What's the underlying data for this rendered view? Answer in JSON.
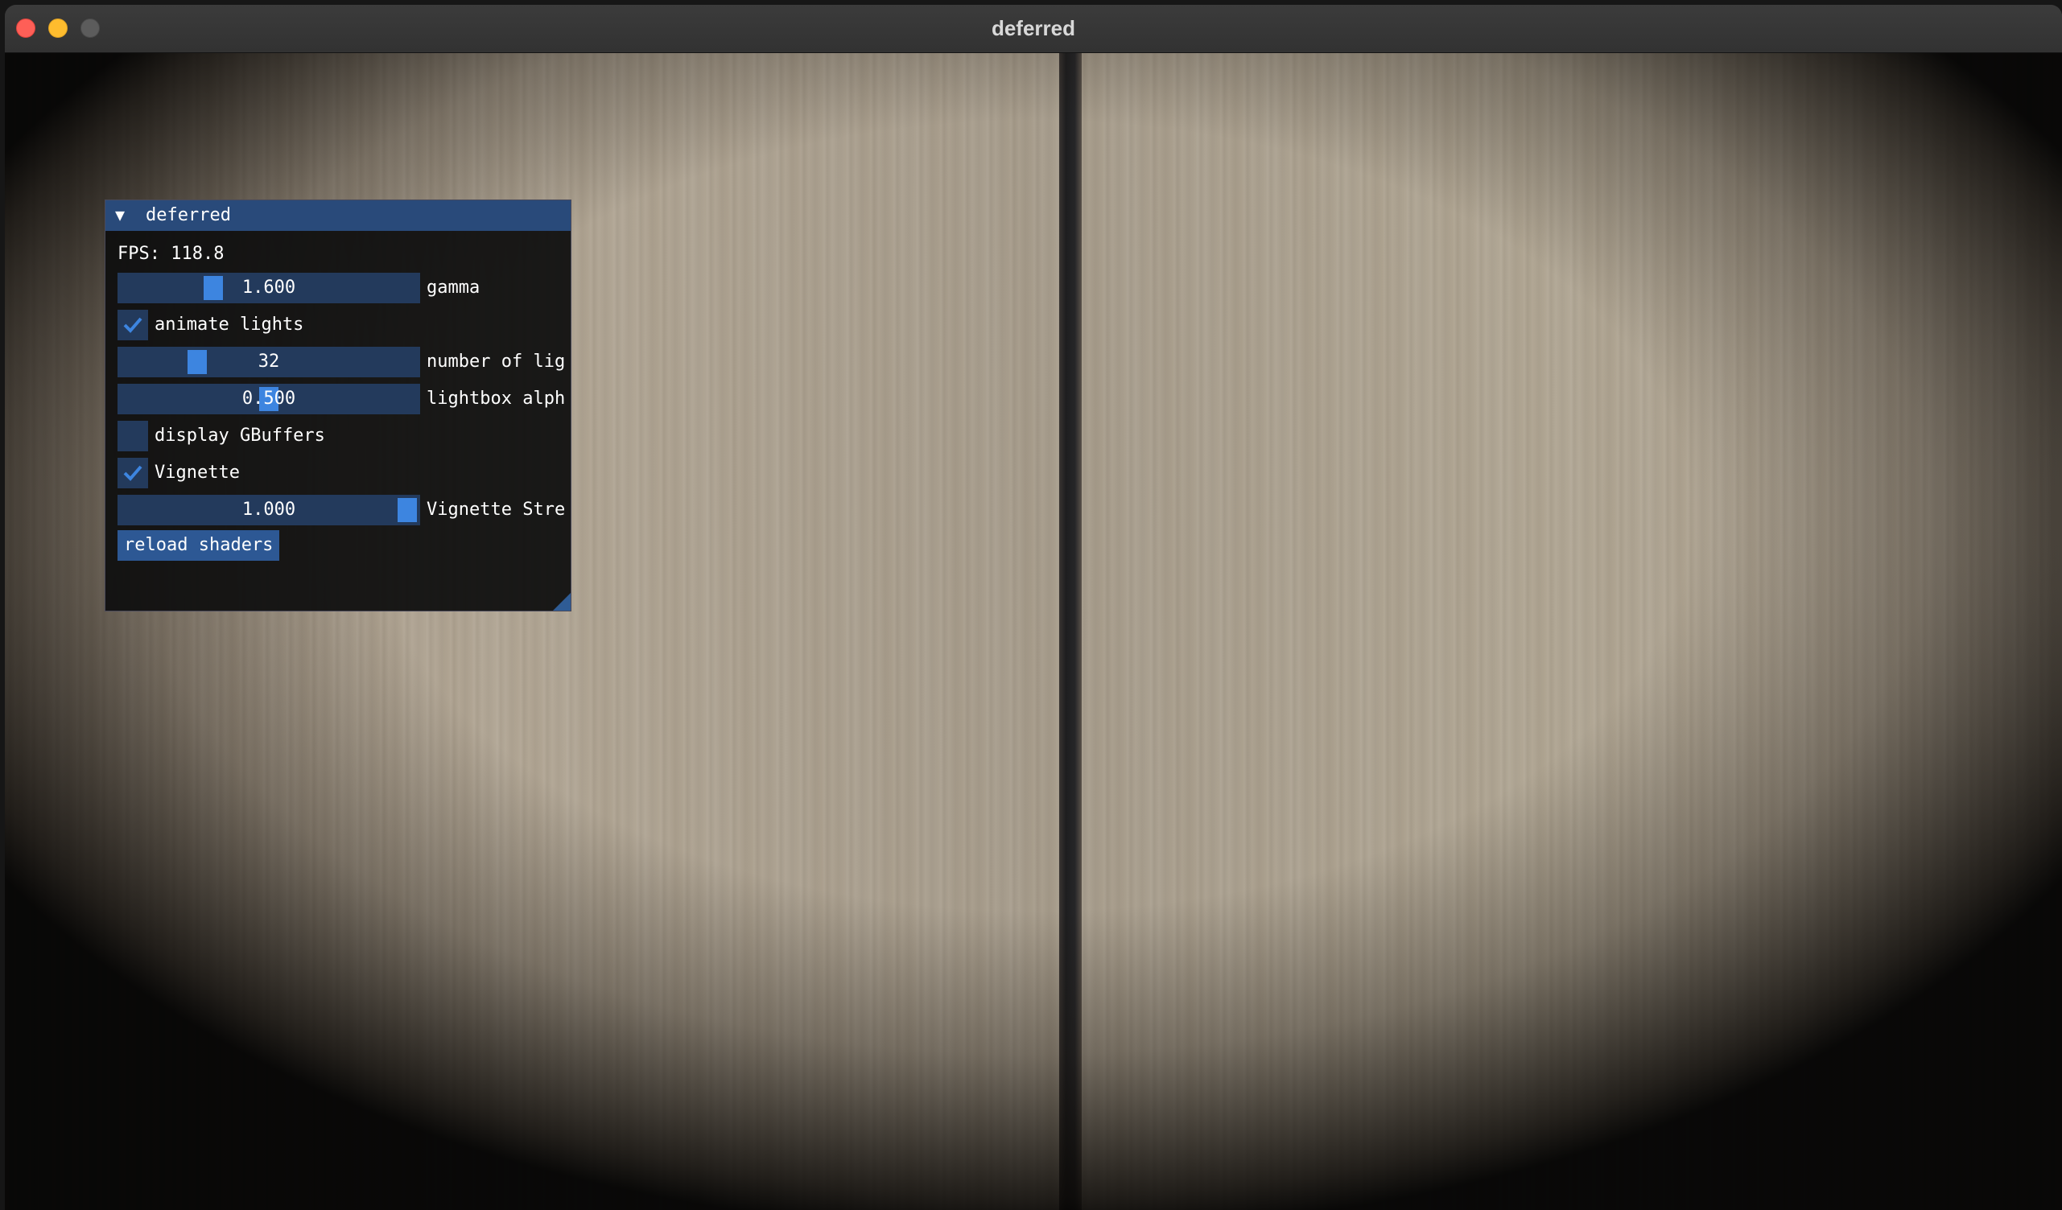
{
  "window": {
    "title": "deferred"
  },
  "panel": {
    "title": "deferred",
    "fps_text": "FPS: 118.8",
    "gamma": {
      "value": "1.600",
      "label": "gamma",
      "fraction": 0.3
    },
    "animate_lights": {
      "label": "animate lights",
      "checked": true
    },
    "num_lights": {
      "value": "32",
      "label": "number of lig",
      "fraction": 0.24
    },
    "lightbox_alpha": {
      "value": "0.500",
      "label": "lightbox alph",
      "fraction": 0.5
    },
    "display_gbuffers": {
      "label": "display GBuffers",
      "checked": false
    },
    "vignette": {
      "label": "Vignette",
      "checked": true
    },
    "vignette_strength": {
      "value": "1.000",
      "label": "Vignette Stre",
      "fraction": 1.0
    },
    "reload_button": "reload shaders"
  },
  "colors": {
    "panel_header": "#294a7a",
    "slider_bg": "#233a5c",
    "slider_grab": "#3d85e0",
    "button": "#2d5894"
  }
}
